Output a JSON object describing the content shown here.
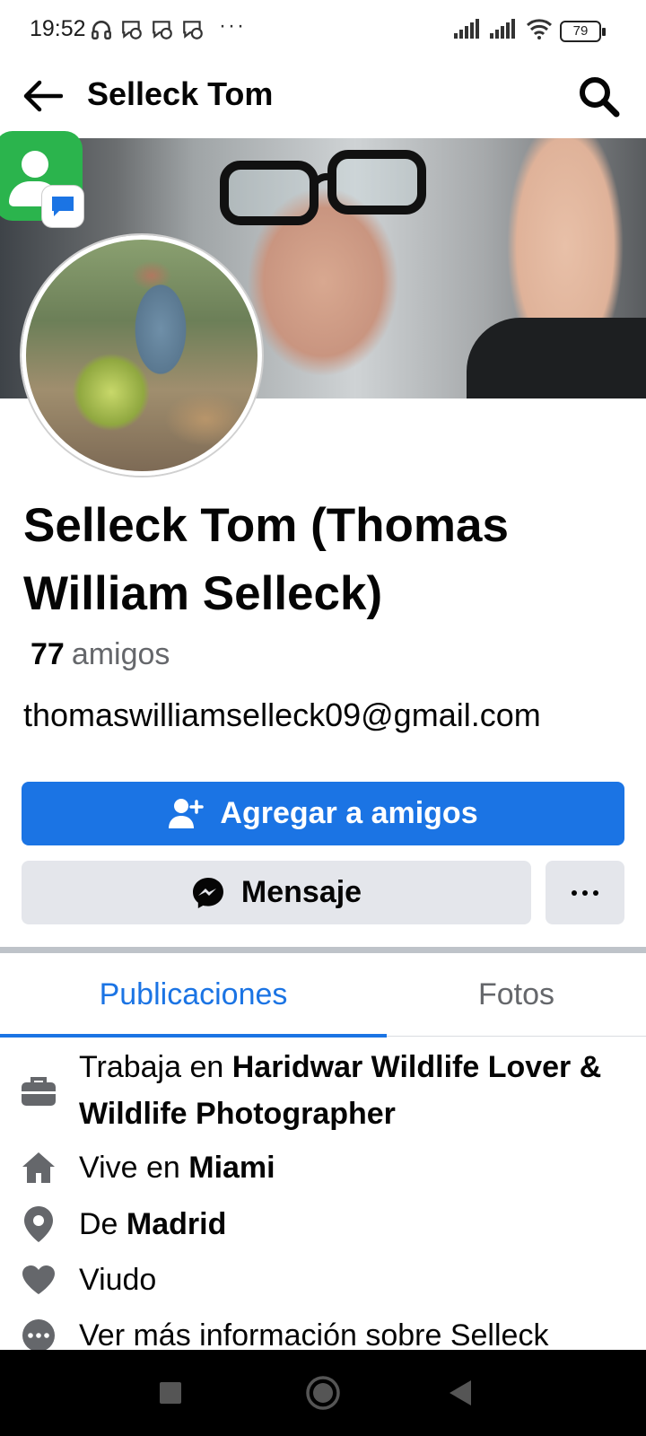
{
  "status_bar": {
    "time": "19:52",
    "battery": "79",
    "left_icons": [
      "headphones-icon",
      "messenger-notification-icon",
      "messenger-notification-icon",
      "messenger-notification-icon",
      "more-notifications-icon"
    ],
    "right_icons": [
      "signal-icon",
      "signal-icon",
      "wifi-icon",
      "battery-icon"
    ]
  },
  "app_bar": {
    "title": "Selleck Tom"
  },
  "profile": {
    "name": "Selleck Tom (Thomas William Selleck)",
    "friends_count": "77",
    "friends_label": "amigos",
    "email": "thomaswilliamselleck09@gmail.com"
  },
  "actions": {
    "add_friend": "Agregar a amigos",
    "message": "Mensaje"
  },
  "tabs": [
    {
      "label": "Publicaciones",
      "active": true
    },
    {
      "label": "Fotos",
      "active": false
    }
  ],
  "intro": {
    "work_prefix": "Trabaja en ",
    "work_place": "Haridwar Wildlife Lover & Wildlife Photographer",
    "lives_prefix": "Vive en ",
    "lives_place": "Miami",
    "from_prefix": "De ",
    "from_place": "Madrid",
    "relationship": "Viudo",
    "more_info": "Ver más información sobre Selleck"
  },
  "colors": {
    "primary": "#1b74e4",
    "secondary_button": "#e4e6eb",
    "text_secondary": "#65676b",
    "nav_bar": "#000000"
  }
}
